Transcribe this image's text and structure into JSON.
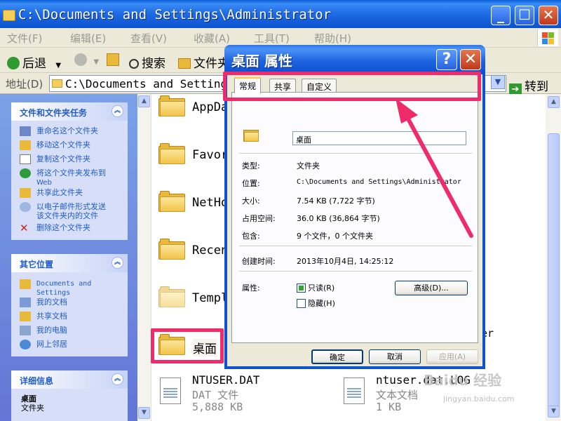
{
  "window": {
    "title": "C:\\Documents and Settings\\Administrator"
  },
  "menubar": {
    "items": [
      "文件(F)",
      "编辑(E)",
      "查看(V)",
      "收藏(A)",
      "工具(T)",
      "帮助(H)"
    ]
  },
  "toolbar": {
    "back_label": "后退",
    "search_label": "搜索",
    "folders_label": "文件夹"
  },
  "addressbar": {
    "label": "地址(D)",
    "value": "C:\\Documents and Settings\\Administrator",
    "go_label": "转到"
  },
  "taskpane": {
    "file_tasks": {
      "title": "文件和文件夹任务",
      "items": [
        {
          "label": "重命名这个文件夹",
          "icon": "rename-icon"
        },
        {
          "label": "移动这个文件夹",
          "icon": "move-icon"
        },
        {
          "label": "复制这个文件夹",
          "icon": "copy-icon"
        },
        {
          "label1": "将这个文件夹发布到",
          "label2": "Web",
          "icon": "globe-icon"
        },
        {
          "label": "共享此文件夹",
          "icon": "share-icon"
        },
        {
          "label1": "以电子邮件形式发送",
          "label2": "该文件夹内的文件",
          "icon": "email-icon"
        },
        {
          "label": "删除这个文件夹",
          "icon": "delete-icon"
        }
      ]
    },
    "other_places": {
      "title": "其它位置",
      "items": [
        {
          "label1": "Documents and",
          "label2": "Settings",
          "icon": "folder-icon"
        },
        {
          "label": "我的文档",
          "icon": "my-documents-icon"
        },
        {
          "label": "共享文档",
          "icon": "shared-documents-icon"
        },
        {
          "label": "我的电脑",
          "icon": "my-computer-icon"
        },
        {
          "label": "网上邻居",
          "icon": "network-icon"
        }
      ]
    },
    "details": {
      "title": "详细信息",
      "name": "桌面",
      "type": "文件夹"
    }
  },
  "files": {
    "folders": [
      "AppDa",
      "Favor",
      "NetHo",
      "Recen",
      "Templ",
      "桌面"
    ],
    "right_fragments": [
      "a",
      "er"
    ],
    "ntuser": {
      "name": "NTUSER.DAT",
      "type": "DAT 文件",
      "size": "5,888 KB"
    },
    "ntuserlog": {
      "name": "ntuser.dat.LOG",
      "type": "文本文档",
      "size": "1 KB"
    }
  },
  "dialog": {
    "title": "桌面 属性",
    "tabs": [
      "常规",
      "共享",
      "自定义"
    ],
    "name_value": "桌面",
    "rows": {
      "type_label": "类型:",
      "type_value": "文件夹",
      "location_label": "位置:",
      "location_value": "C:\\Documents and Settings\\Administrator",
      "size_label": "大小:",
      "size_value": "7.54 KB (7,722 字节)",
      "disk_label": "占用空间:",
      "disk_value": "36.0 KB (36,864 字节)",
      "contains_label": "包含:",
      "contains_value": "9 个文件，0 个文件夹",
      "created_label": "创建时间:",
      "created_value": "2013年10月4日, 14:25:12",
      "attr_label": "属性:"
    },
    "readonly_label": "只读(R)",
    "hidden_label": "隐藏(H)",
    "advanced_label": "高级(D)...",
    "ok_label": "确定",
    "cancel_label": "取消",
    "apply_label": "应用(A)",
    "readonly_checked": true,
    "hidden_checked": false
  },
  "annotation": {
    "color": "#ef2b6a"
  },
  "watermark": {
    "text": "Baidu 经验",
    "url": "jingyan.baidu.com"
  }
}
